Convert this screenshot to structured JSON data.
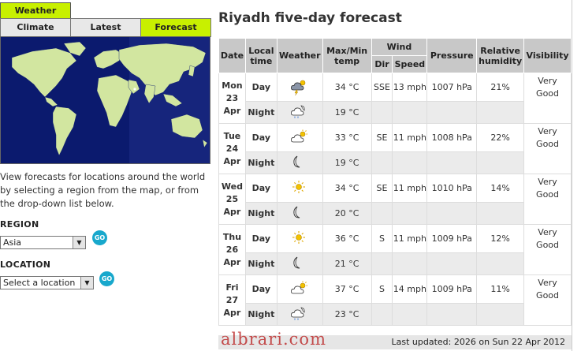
{
  "nav": {
    "weather_tab": "Weather",
    "subtabs": [
      "Climate",
      "Latest",
      "Forecast"
    ]
  },
  "intro": "View forecasts for locations around the world by selecting a region from the map, or from the drop-down list below.",
  "region": {
    "label": "REGION",
    "value": "Asia",
    "go": "GO"
  },
  "location": {
    "label": "LOCATION",
    "value": "Select a location",
    "go": "GO"
  },
  "forecast": {
    "title": "Riyadh five-day forecast",
    "headers": {
      "date": "Date",
      "local": "Local time",
      "weather": "Weather",
      "temp": "Max/Min temp",
      "wind": "Wind",
      "dir": "Dir",
      "speed": "Speed",
      "pressure": "Pressure",
      "humidity": "Relative humidity",
      "visibility": "Visibility"
    },
    "days": [
      {
        "day": "Mon",
        "num": "23",
        "mon": "Apr",
        "d": {
          "label": "Day",
          "icon": "partly-cloudy-thunder-icon",
          "temp": "34 °C",
          "dir": "SSE",
          "speed": "13 mph",
          "pressure": "1007 hPa",
          "humidity": "21%",
          "vis1": "Very",
          "vis2": "Good"
        },
        "n": {
          "label": "Night",
          "icon": "cloudy-night-drizzle-icon",
          "temp": "19 °C"
        }
      },
      {
        "day": "Tue",
        "num": "24",
        "mon": "Apr",
        "d": {
          "label": "Day",
          "icon": "sunny-intervals-icon",
          "temp": "33 °C",
          "dir": "SE",
          "speed": "11 mph",
          "pressure": "1008 hPa",
          "humidity": "22%",
          "vis1": "Very",
          "vis2": "Good"
        },
        "n": {
          "label": "Night",
          "icon": "clear-night-icon",
          "temp": "19 °C"
        }
      },
      {
        "day": "Wed",
        "num": "25",
        "mon": "Apr",
        "d": {
          "label": "Day",
          "icon": "sunny-icon",
          "temp": "34 °C",
          "dir": "SE",
          "speed": "11 mph",
          "pressure": "1010 hPa",
          "humidity": "14%",
          "vis1": "Very",
          "vis2": "Good"
        },
        "n": {
          "label": "Night",
          "icon": "clear-night-icon",
          "temp": "20 °C"
        }
      },
      {
        "day": "Thu",
        "num": "26",
        "mon": "Apr",
        "d": {
          "label": "Day",
          "icon": "sunny-icon",
          "temp": "36 °C",
          "dir": "S",
          "speed": "11 mph",
          "pressure": "1009 hPa",
          "humidity": "12%",
          "vis1": "Very",
          "vis2": "Good"
        },
        "n": {
          "label": "Night",
          "icon": "clear-night-icon",
          "temp": "21 °C"
        }
      },
      {
        "day": "Fri",
        "num": "27",
        "mon": "Apr",
        "d": {
          "label": "Day",
          "icon": "sunny-intervals-icon",
          "temp": "37 °C",
          "dir": "S",
          "speed": "14 mph",
          "pressure": "1009 hPa",
          "humidity": "11%",
          "vis1": "Very",
          "vis2": "Good"
        },
        "n": {
          "label": "Night",
          "icon": "cloudy-night-drizzle-icon",
          "temp": "23 °C"
        }
      }
    ],
    "footer": "Last updated: 2026 on Sun 22 Apr 2012"
  },
  "watermark": "albrari.com",
  "colors": {
    "accent": "#c8f000",
    "map_sea": "#0b1a6e",
    "map_land": "#d2e6a0",
    "go": "#18a8cc"
  }
}
